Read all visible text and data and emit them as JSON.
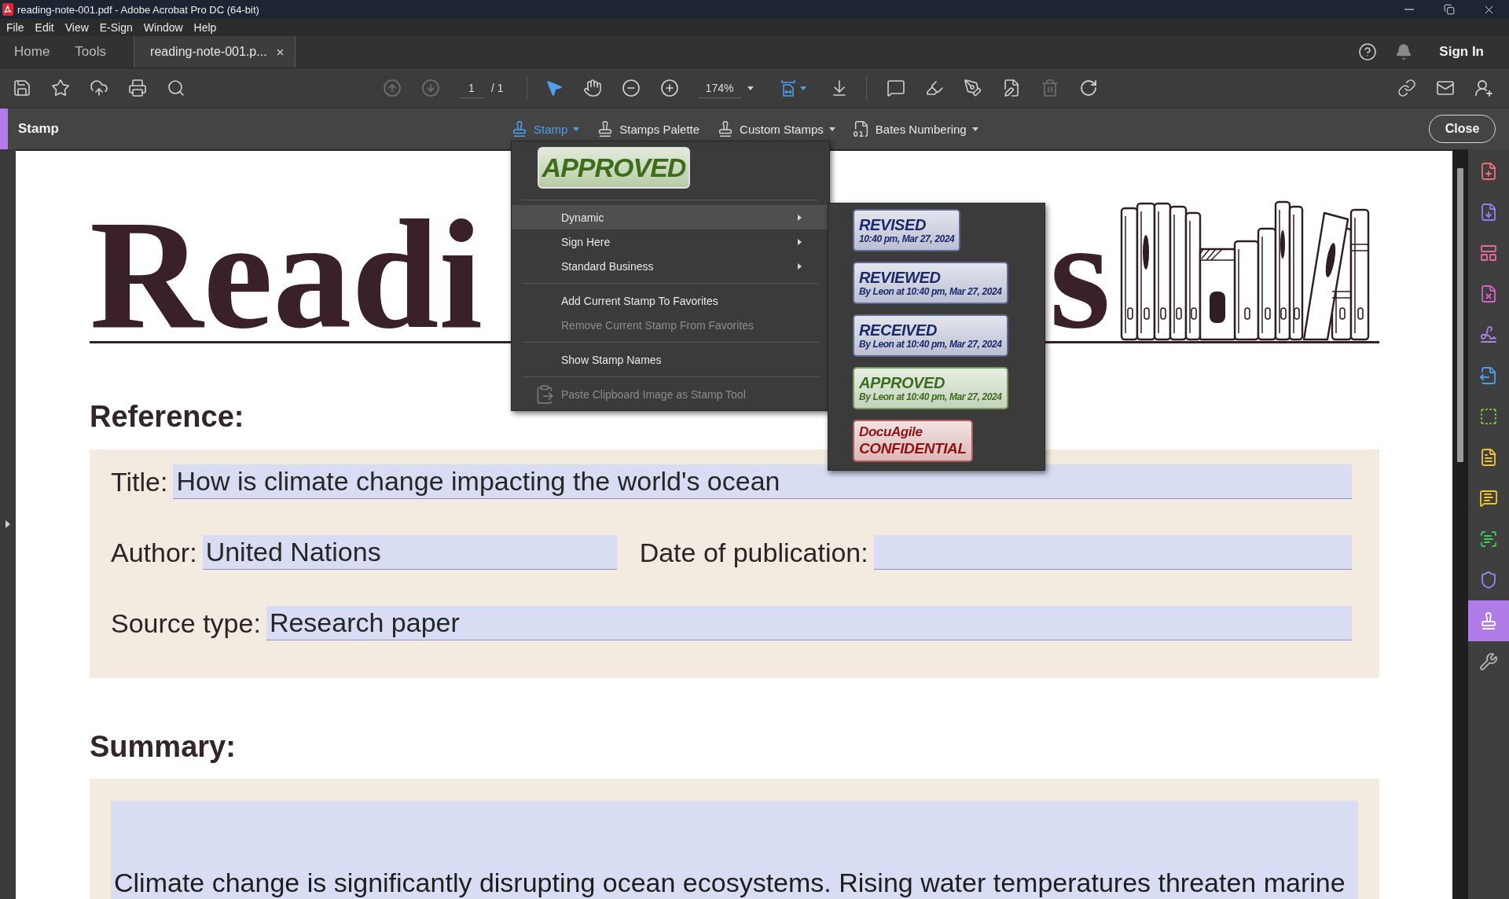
{
  "window": {
    "title": "reading-note-001.pdf - Adobe Acrobat Pro DC (64-bit)"
  },
  "menu_bar": [
    "File",
    "Edit",
    "View",
    "E-Sign",
    "Window",
    "Help"
  ],
  "tabs": [
    {
      "label": "Home",
      "selected": false,
      "closable": false
    },
    {
      "label": "Tools",
      "selected": false,
      "closable": false
    },
    {
      "label": "reading-note-001.p...",
      "selected": true,
      "closable": true
    }
  ],
  "account": {
    "sign_in": "Sign In"
  },
  "toolbar": {
    "page_buttons": [
      {
        "disabled": true
      },
      {
        "disabled": true
      }
    ],
    "page_number": "1",
    "page_count": "/ 1",
    "pointer_tools": [
      {
        "selected": true
      },
      {
        "selected": false
      }
    ],
    "zoom": "174%",
    "delete_disabled": true
  },
  "stamp_bar": {
    "title": "Stamp",
    "tools": [
      {
        "label": "Stamp",
        "selected": true,
        "has_menu": true
      },
      {
        "label": "Stamps Palette",
        "selected": false,
        "has_menu": false
      },
      {
        "label": "Custom Stamps",
        "selected": false,
        "has_menu": true
      },
      {
        "label": "Bates Numbering",
        "selected": false,
        "has_menu": true
      }
    ],
    "close": "Close"
  },
  "stamp_menu": {
    "current_stamp": {
      "text": "APPROVED"
    },
    "sections": [
      {
        "items": [
          {
            "kind": "submenu",
            "label": "Dynamic",
            "selected": true,
            "disabled": false
          },
          {
            "kind": "submenu",
            "label": "Sign Here",
            "selected": false,
            "disabled": false
          },
          {
            "kind": "submenu",
            "label": "Standard Business",
            "selected": false,
            "disabled": false
          }
        ]
      },
      {
        "items": [
          {
            "kind": "action",
            "label": "Add Current Stamp To Favorites",
            "selected": false,
            "disabled": false
          },
          {
            "kind": "action",
            "label": "Remove Current Stamp From Favorites",
            "selected": false,
            "disabled": true
          }
        ]
      },
      {
        "items": [
          {
            "kind": "action",
            "label": "Show Stamp Names",
            "selected": false,
            "disabled": false
          }
        ]
      },
      {
        "items": [
          {
            "kind": "image_action",
            "label": "Paste Clipboard Image as Stamp Tool",
            "selected": false,
            "disabled": true
          }
        ]
      }
    ],
    "submenu": [
      {
        "kind": "dynamic",
        "lines": [
          "REVISED",
          "10:40 pm, Mar 27, 2024"
        ],
        "color": "#1c2a6b"
      },
      {
        "kind": "dynamic",
        "lines": [
          "REVIEWED",
          "By Leon at 10:40 pm, Mar 27, 2024"
        ],
        "color": "#1c2a6b"
      },
      {
        "kind": "dynamic",
        "lines": [
          "RECEIVED",
          "By Leon at 10:40 pm, Mar 27, 2024"
        ],
        "color": "#1c2a6b"
      },
      {
        "kind": "dynamic",
        "lines": [
          "APPROVED",
          "By Leon at 10:40 pm, Mar 27, 2024"
        ],
        "color": "#3c6d1d"
      },
      {
        "kind": "brand",
        "lines": [
          "DocuAgile",
          "CONFIDENTIAL"
        ],
        "color": "#8e1212"
      }
    ]
  },
  "document": {
    "heading_fragments": [
      "Readi",
      "s"
    ],
    "reference": {
      "heading": "Reference:",
      "rows": [
        {
          "fields": [
            {
              "label": "Title:",
              "value": "How is climate change impacting the world's ocean"
            }
          ]
        },
        {
          "fields": [
            {
              "label": "Author:",
              "value": "United Nations"
            },
            {
              "label": "Date of publication:"
            }
          ]
        },
        {
          "fields": [
            {
              "label": "Source type:",
              "value": "Research paper"
            }
          ]
        }
      ]
    },
    "summary": {
      "heading": "Summary:",
      "text": "Climate change is significantly disrupting ocean ecosystems. Rising water temperatures threaten marine"
    }
  },
  "tool_pane": [
    {
      "selected": false
    },
    {
      "selected": false
    },
    {
      "selected": false
    },
    {
      "selected": false
    },
    {
      "selected": false
    },
    {
      "selected": false
    },
    {
      "selected": false
    },
    {
      "selected": false
    },
    {
      "selected": false
    },
    {
      "selected": false
    },
    {
      "selected": false
    },
    {
      "selected": true
    },
    {
      "selected": false
    }
  ]
}
